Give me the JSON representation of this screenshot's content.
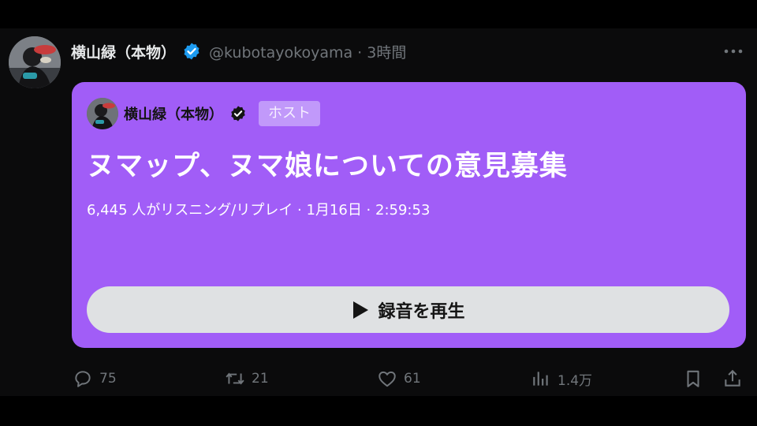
{
  "tweet": {
    "author": {
      "display_name": "横山緑（本物）",
      "handle_time": "@kubotayokoyama · 3時間",
      "verified_color": "#1d9bf0"
    },
    "space_card": {
      "background_color": "#a15df7",
      "host_name": "横山緑（本物）",
      "host_badge": "ホスト",
      "title": "ヌマップ、ヌマ娘についての意見募集",
      "meta": "6,445 人がリスニング/リプレイ · 1月16日 · 2:59:53",
      "play_label": "録音を再生"
    },
    "actions": {
      "reply_count": "75",
      "retweet_count": "21",
      "like_count": "61",
      "view_count": "1.4万"
    },
    "icons": [
      "verified-badge-icon",
      "more-icon",
      "play-icon",
      "reply-icon",
      "retweet-icon",
      "like-icon",
      "views-icon",
      "bookmark-icon",
      "share-icon"
    ]
  }
}
